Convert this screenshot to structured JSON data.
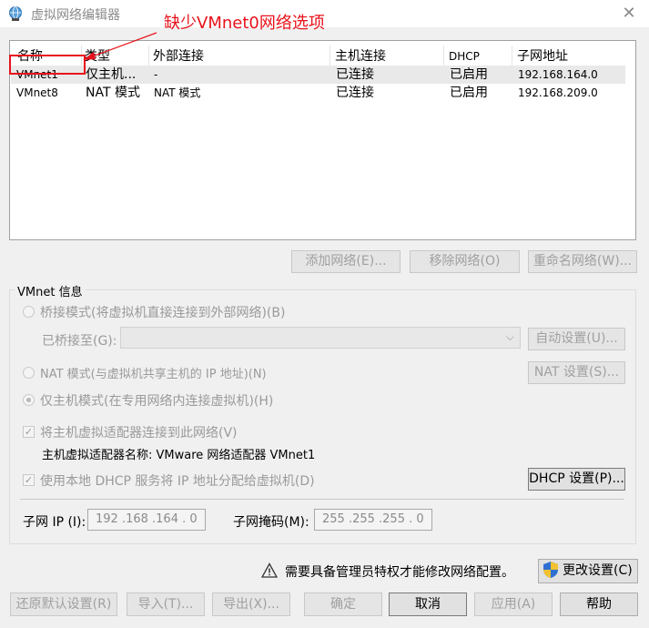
{
  "window": {
    "title": "虚拟网络编辑器",
    "close_symbol": "✕"
  },
  "annotation": {
    "text": "缺少VMnet0网络选项",
    "color": "#e8121b"
  },
  "table": {
    "headers": [
      "名称",
      "类型",
      "外部连接",
      "主机连接",
      "DHCP",
      "子网地址"
    ],
    "rows": [
      {
        "name": "VMnet1",
        "type": "仅主机...",
        "external": "-",
        "host": "已连接",
        "dhcp": "已启用",
        "subnet": "192.168.164.0",
        "selected": true
      },
      {
        "name": "VMnet8",
        "type": "NAT 模式",
        "external": "NAT 模式",
        "host": "已连接",
        "dhcp": "已启用",
        "subnet": "192.168.209.0",
        "selected": false
      }
    ]
  },
  "table_buttons": {
    "add": "添加网络(E)...",
    "remove": "移除网络(O)",
    "rename": "重命名网络(W)..."
  },
  "vmnet_info": {
    "group_title": "VMnet 信息",
    "bridged_label": "桥接模式(将虚拟机直接连接到外部网络)(B)",
    "bridged_to_label": "已桥接至(G):",
    "bridged_to_value": "",
    "auto_settings": "自动设置(U)...",
    "nat_label": "NAT 模式(与虚拟机共享主机的 IP 地址)(N)",
    "nat_settings": "NAT 设置(S)...",
    "hostonly_label": "仅主机模式(在专用网络内连接虚拟机)(H)",
    "connect_adapter_label": "将主机虚拟适配器连接到此网络(V)",
    "adapter_name_label": "主机虚拟适配器名称: VMware 网络适配器 VMnet1",
    "dhcp_label": "使用本地 DHCP 服务将 IP 地址分配给虚拟机(D)",
    "dhcp_settings": "DHCP 设置(P)...",
    "subnet_ip_label": "子网 IP (I):",
    "subnet_ip_value": "192 .168 .164 .  0",
    "subnet_mask_label": "子网掩码(M):",
    "subnet_mask_value": "255 .255 .255 .  0"
  },
  "admin": {
    "warning_text": "需要具备管理员特权才能修改网络配置。",
    "change_settings": "更改设置(C)"
  },
  "bottom_buttons": {
    "restore": "还原默认设置(R)",
    "import": "导入(T)...",
    "export": "导出(X)...",
    "ok": "确定",
    "cancel": "取消",
    "apply": "应用(A)",
    "help": "帮助"
  },
  "icons": {
    "app": "network-globe-icon",
    "close": "close-icon",
    "warning": "warning-icon",
    "shield": "uac-shield-icon",
    "dropdown": "chevron-down-icon"
  }
}
